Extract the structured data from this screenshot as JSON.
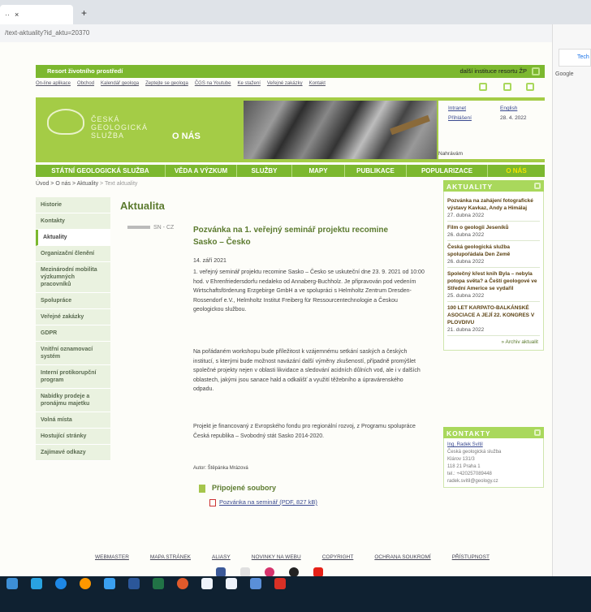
{
  "browser": {
    "tab_close": "×",
    "new_tab": "+",
    "url": "/text-aktuality?id_aktu=20370",
    "side_tab": "Tech",
    "side_google": "Google"
  },
  "topbar": {
    "left": "Resort životního prostředí",
    "right": "další instituce resortu ŽP"
  },
  "toplinks": [
    "On-line aplikace",
    "Obchod",
    "Kalendář geologa",
    "Zeptejte se geologa",
    "ČGS na Youtube",
    "Ke stažení",
    "Veřejné zakázky",
    "Kontakt"
  ],
  "banner": {
    "logo_line1": "ČESKÁ",
    "logo_line2": "GEOLOGICKÁ",
    "logo_line3": "SLUŽBA",
    "section": "O NÁS",
    "intranet": "Intranet",
    "english": "English",
    "login": "Přihlášení",
    "date": "28. 4. 2022",
    "loading": "Nahrávám"
  },
  "mainnav": [
    "STÁTNÍ GEOLOGICKÁ SLUŽBA",
    "VĚDA A VÝZKUM",
    "SLUŽBY",
    "MAPY",
    "PUBLIKACE",
    "POPULARIZACE",
    "O NÁS"
  ],
  "breadcrumb": {
    "a": "Úvod",
    "sep": " > ",
    "b": "O nás",
    "c": "Aktuality",
    "d": "Text aktuality"
  },
  "sidebar": [
    "Historie",
    "Kontakty",
    "Aktuality",
    "Organizační členění",
    "Mezinárodní mobilita výzkumných pracovníků",
    "Spolupráce",
    "Veřejné zakázky",
    "GDPR",
    "Vnitřní oznamovací systém",
    "Interní protikorupční program",
    "Nabídky prodeje a pronájmu majetku",
    "Volná místa",
    "Hostující stránky",
    "Zajímavé odkazy"
  ],
  "article": {
    "heading": "Aktualita",
    "flag": "SN - CZ",
    "title": "Pozvánka na 1. veřejný seminář projektu recomine Sasko – Česko",
    "date": "14. září 2021",
    "p1": "1. veřejný seminář projektu recomine Sasko – Česko se uskuteční dne 23. 9. 2021 od 10:00 hod. v Ehrenfriedersdorfu nedaleko od Annaberg-Buchholz. Je připravován pod vedením Wirtschaftsförderung Erzgebirge GmbH a ve spolupráci s Helmholtz Zentrum Dresden-Rossendorf e.V., Helmholtz Institut Freiberg für Ressourcentechnologie a Českou geologickou službou.",
    "p2": "Na pořádaném workshopu bude příležitost k vzájemnému setkání saských a českých institucí, s kterými bude možnost navázání další výměny zkušeností, případně promýšlet společné projekty nejen v oblasti likvidace a sledování acidních důlních vod, ale i v dalších oblastech, jakými jsou sanace hald a odkališť a využití těžebního a úpravárenského odpadu.",
    "p3": "Projekt je financovaný z Evropského fondu pro regionální rozvoj, z Programu spolupráce Česká republika – Svobodný stát Sasko 2014-2020.",
    "author": "Autor: Štěpánka Mrázová",
    "files_heading": "Připojené soubory",
    "file_link": "Pozvánka na seminář (PDF, 827 kB)"
  },
  "aktuality": {
    "heading": "AKTUALITY",
    "items": [
      {
        "title": "Pozvánka na zahájení fotografické výstavy Kavkaz, Andy a Himálaj",
        "date": "27. dubna 2022"
      },
      {
        "title": "Film o geologii Jeseníků",
        "date": "26. dubna 2022"
      },
      {
        "title": "Česká geologická služba spolupořádala Den Země",
        "date": "26. dubna 2022"
      },
      {
        "title": "Společný křest knih Byla – nebyla potopa světa? a Čeští geologové ve Střední Americe se vydařil",
        "date": "25. dubna 2022"
      },
      {
        "title": "100 LET KARPATO-BALKÁNSKÉ ASOCIACE A JEJÍ 22. KONGRES V PLOVDIVU",
        "date": "21. dubna 2022"
      }
    ],
    "archive": "» Archiv aktualit"
  },
  "kontakty": {
    "heading": "KONTAKTY",
    "name": "Ing. Radek Svítil",
    "l1": "Česká geologická služba",
    "l2": "Klárov 131/3",
    "l3": "118 21 Praha 1",
    "l4": "tel.: +420257089448",
    "l5": "radek.svitil@geology.cz"
  },
  "footer": [
    "WEBMASTER",
    "MAPA STRÁNEK",
    "ALIASY",
    "NOVINKY NA WEBU",
    "COPYRIGHT",
    "OCHRANA SOUKROMÍ",
    "PŘÍSTUPNOST"
  ],
  "colors": {
    "brand_green": "#7cb82f",
    "light_green": "#a9d85c",
    "heading_green": "#5b7a2e",
    "taskbar": "#0f2131"
  }
}
